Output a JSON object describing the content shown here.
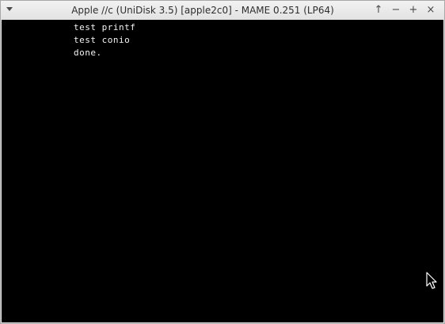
{
  "window": {
    "title": "Apple //c (UniDisk 3.5) [apple2c0] - MAME 0.251 (LP64)",
    "controls": {
      "keep_above": "↑",
      "minimize": "−",
      "maximize": "+",
      "close": "×"
    }
  },
  "terminal": {
    "lines": [
      "test printf",
      "test conio",
      "done."
    ]
  },
  "colors": {
    "screen_background": "#000000",
    "screen_text": "#f4f4f4",
    "titlebar": "#e9e9e9"
  }
}
